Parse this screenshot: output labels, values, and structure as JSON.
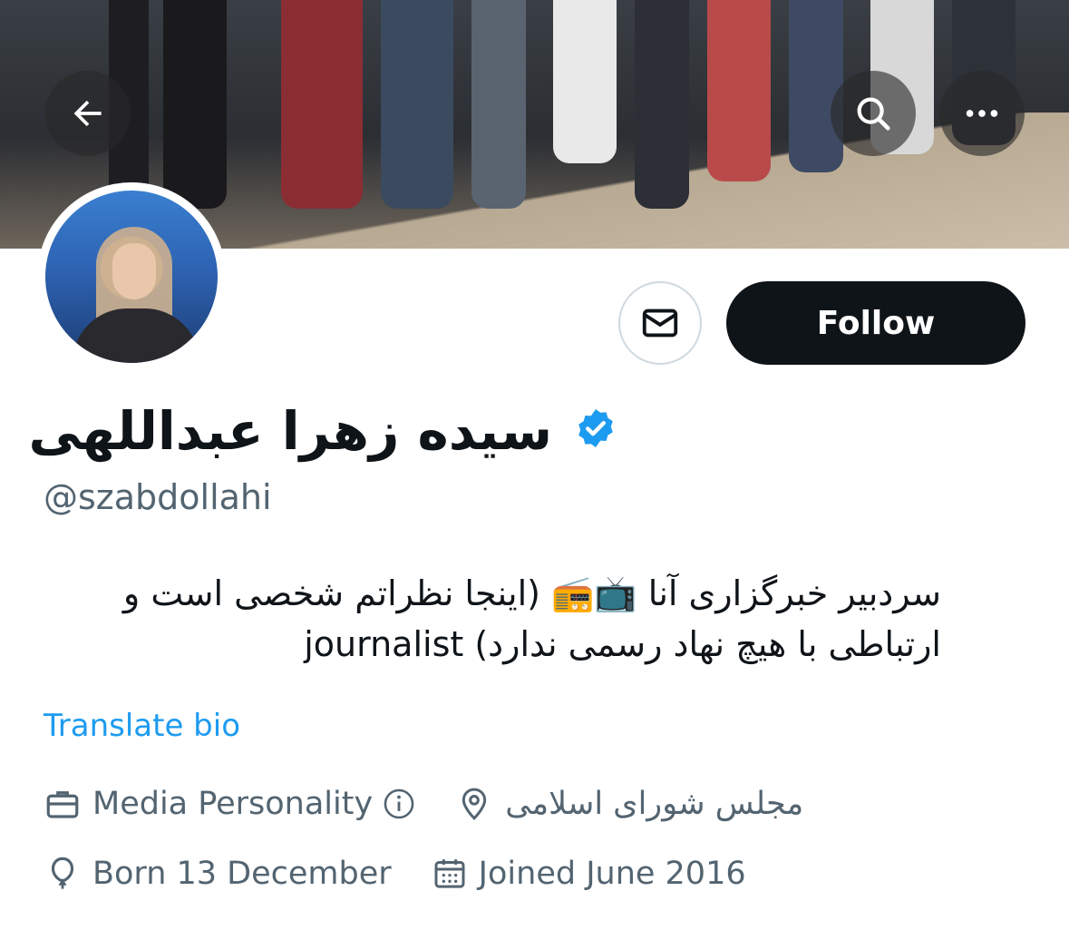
{
  "header": {
    "back_icon": "arrow-left-icon",
    "search_icon": "search-icon",
    "more_icon": "more-horizontal-icon"
  },
  "profile": {
    "display_name": "سیده زهرا عبداللهی",
    "verified": true,
    "handle": "@szabdollahi",
    "bio_line_1": "سردبیر خبرگزاری آنا 📺📻 (اینجا نظراتم شخصی است و",
    "bio_line_2": "ارتباطی با هیچ نهاد رسمی ندارد) journalist",
    "translate_label": "Translate bio",
    "category": "Media Personality",
    "location": "مجلس شورای اسلامی",
    "birthday": "Born 13 December",
    "joined": "Joined June 2016"
  },
  "actions": {
    "follow_label": "Follow",
    "message_icon": "mail-icon"
  },
  "colors": {
    "primary_text": "#0f1419",
    "secondary_text": "#536471",
    "link": "#1d9bf0",
    "verified_badge": "#1d9bf0",
    "follow_bg": "#0f1419"
  }
}
